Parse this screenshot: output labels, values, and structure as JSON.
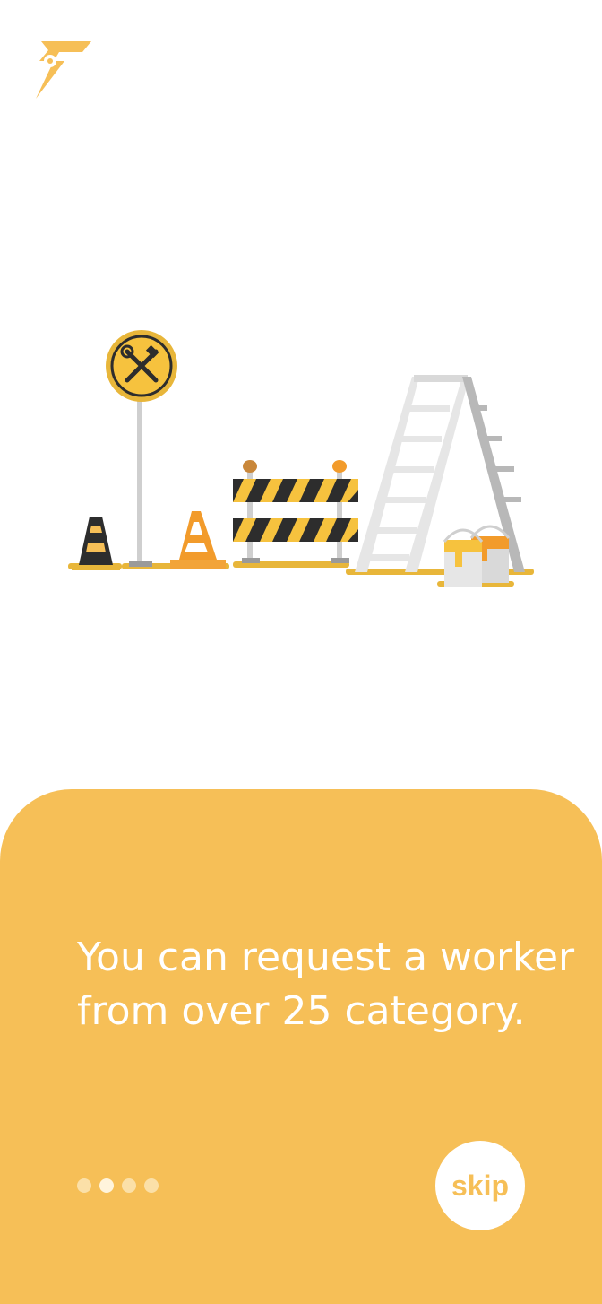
{
  "app": {
    "logo_icon": "lightning-wrench-logo-icon",
    "accent_color": "#F6BF57"
  },
  "illustration": {
    "sign_icon": "tools-crossed-icon",
    "items": [
      "traffic-cone",
      "tool-sign",
      "road-barrier",
      "ladder",
      "paint-buckets"
    ]
  },
  "onboarding": {
    "headline_line1": "You can request a worker",
    "headline_line2": "from over 25 category.",
    "page_count": 4,
    "current_page": 2,
    "skip_label": "skip"
  }
}
